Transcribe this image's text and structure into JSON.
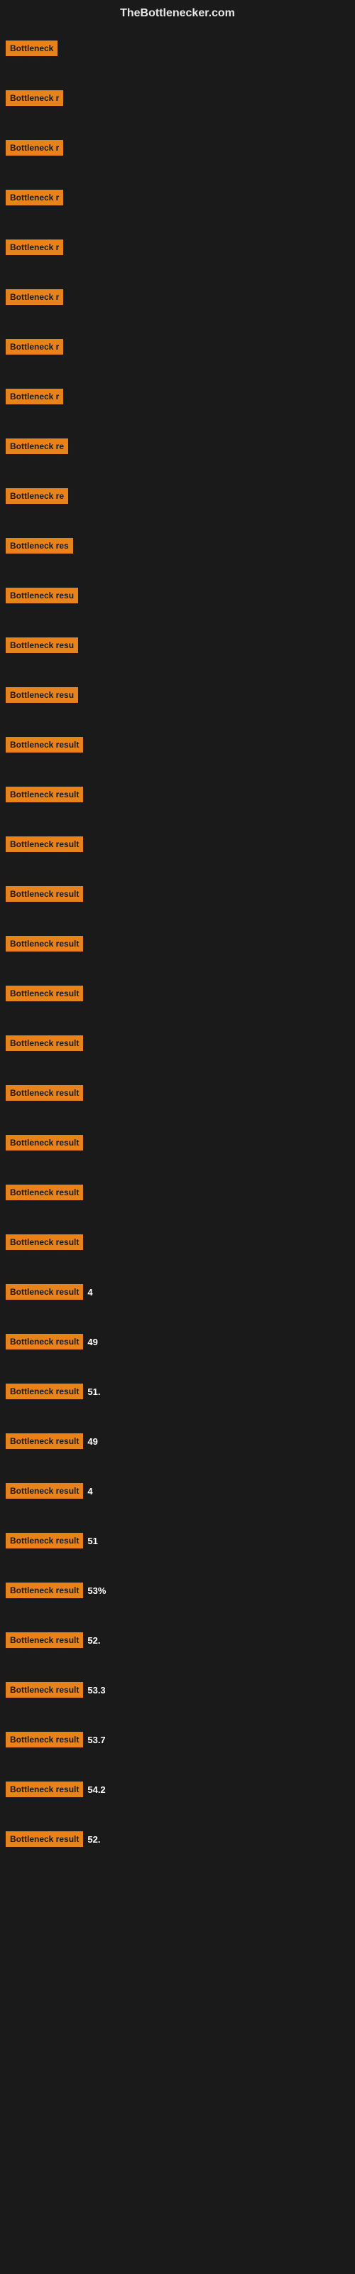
{
  "header": {
    "title": "TheBottlenecker.com"
  },
  "rows": [
    {
      "label": "Bottleneck",
      "value": ""
    },
    {
      "label": "Bottleneck r",
      "value": ""
    },
    {
      "label": "Bottleneck r",
      "value": ""
    },
    {
      "label": "Bottleneck r",
      "value": ""
    },
    {
      "label": "Bottleneck r",
      "value": ""
    },
    {
      "label": "Bottleneck r",
      "value": ""
    },
    {
      "label": "Bottleneck r",
      "value": ""
    },
    {
      "label": "Bottleneck r",
      "value": ""
    },
    {
      "label": "Bottleneck re",
      "value": ""
    },
    {
      "label": "Bottleneck re",
      "value": ""
    },
    {
      "label": "Bottleneck res",
      "value": ""
    },
    {
      "label": "Bottleneck resu",
      "value": ""
    },
    {
      "label": "Bottleneck resu",
      "value": ""
    },
    {
      "label": "Bottleneck resu",
      "value": ""
    },
    {
      "label": "Bottleneck result",
      "value": ""
    },
    {
      "label": "Bottleneck result",
      "value": ""
    },
    {
      "label": "Bottleneck result",
      "value": ""
    },
    {
      "label": "Bottleneck result",
      "value": ""
    },
    {
      "label": "Bottleneck result",
      "value": ""
    },
    {
      "label": "Bottleneck result",
      "value": ""
    },
    {
      "label": "Bottleneck result",
      "value": ""
    },
    {
      "label": "Bottleneck result",
      "value": ""
    },
    {
      "label": "Bottleneck result",
      "value": ""
    },
    {
      "label": "Bottleneck result",
      "value": ""
    },
    {
      "label": "Bottleneck result",
      "value": ""
    },
    {
      "label": "Bottleneck result",
      "value": "4"
    },
    {
      "label": "Bottleneck result",
      "value": "49"
    },
    {
      "label": "Bottleneck result",
      "value": "51."
    },
    {
      "label": "Bottleneck result",
      "value": "49"
    },
    {
      "label": "Bottleneck result",
      "value": "4"
    },
    {
      "label": "Bottleneck result",
      "value": "51"
    },
    {
      "label": "Bottleneck result",
      "value": "53%"
    },
    {
      "label": "Bottleneck result",
      "value": "52."
    },
    {
      "label": "Bottleneck result",
      "value": "53.3"
    },
    {
      "label": "Bottleneck result",
      "value": "53.7"
    },
    {
      "label": "Bottleneck result",
      "value": "54.2"
    },
    {
      "label": "Bottleneck result",
      "value": "52."
    }
  ]
}
